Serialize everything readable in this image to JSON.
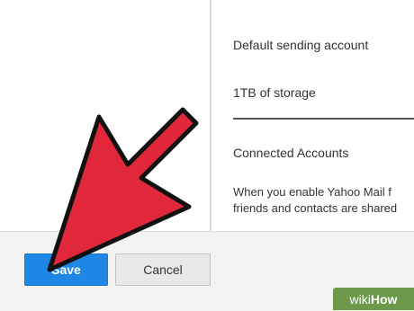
{
  "settings": {
    "default_sending_account": "Default sending account",
    "storage": "1TB of storage",
    "connected_accounts_title": "Connected Accounts",
    "connected_accounts_desc_line1": "When you enable Yahoo Mail f",
    "connected_accounts_desc_line2": "friends and contacts are shared"
  },
  "footer": {
    "save_label": "Save",
    "cancel_label": "Cancel"
  },
  "overlay": {
    "arrow_color": "#e0283a",
    "watermark_wiki": "wiki",
    "watermark_how": "How"
  },
  "colors": {
    "primary_button": "#1e87e5",
    "secondary_button": "#e8e8e8",
    "watermark_bg": "#6c9a4a"
  }
}
